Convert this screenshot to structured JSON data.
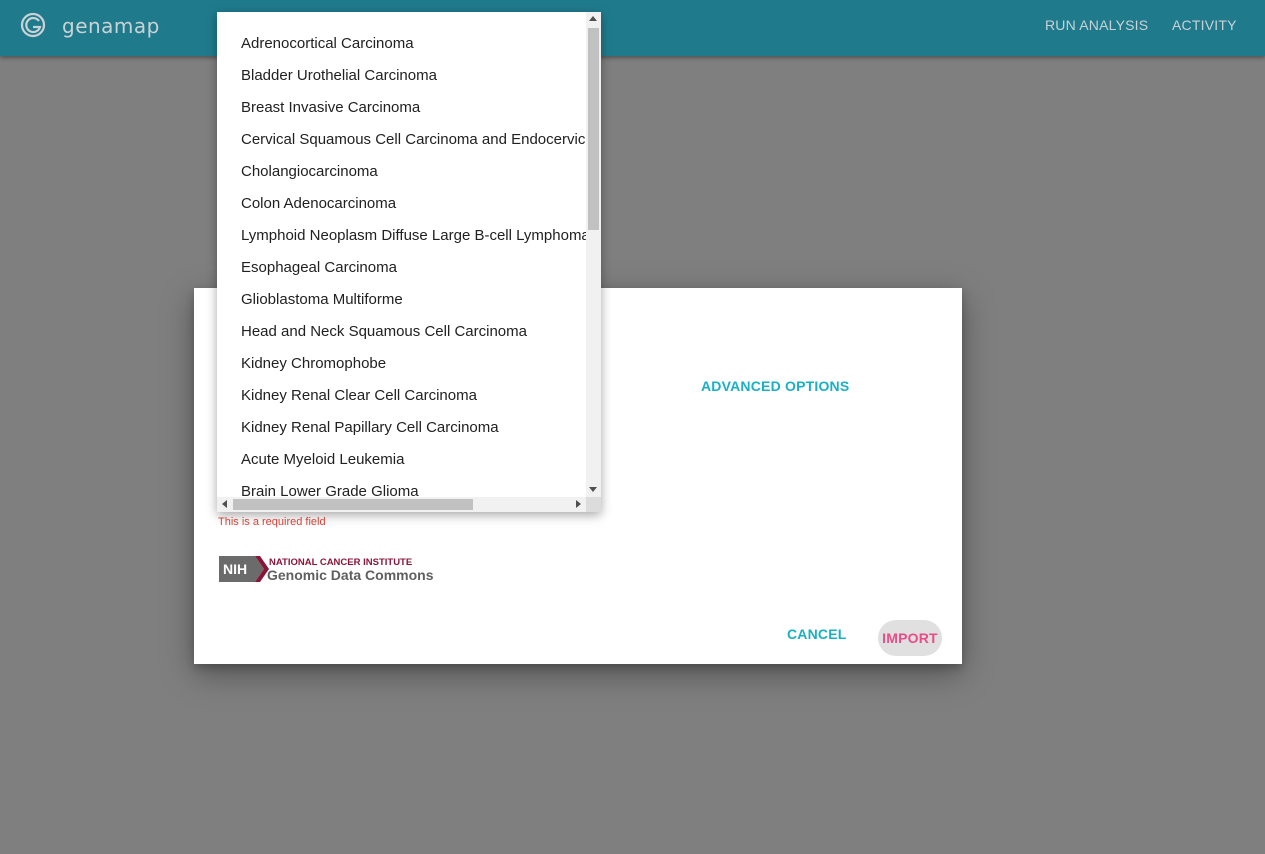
{
  "app": {
    "logo_icon": "genamap-g-logo-icon",
    "name": "genamap",
    "nav": {
      "run_analysis": "RUN ANALYSIS",
      "activity": "ACTIVITY"
    }
  },
  "dialog": {
    "advanced_options": "ADVANCED OPTIONS",
    "error": "This is a required field",
    "nih_logo": {
      "badge": "NIH",
      "line1": "NATIONAL CANCER INSTITUTE",
      "line2": "Genomic Data Commons"
    },
    "cancel_label": "CANCEL",
    "import_label": "IMPORT"
  },
  "dropdown": {
    "items": [
      "Adrenocortical Carcinoma",
      "Bladder Urothelial Carcinoma",
      "Breast Invasive Carcinoma",
      "Cervical Squamous Cell Carcinoma and Endocervical Adenocarcinoma",
      "Cholangiocarcinoma",
      "Colon Adenocarcinoma",
      "Lymphoid Neoplasm Diffuse Large B-cell Lymphoma",
      "Esophageal Carcinoma",
      "Glioblastoma Multiforme",
      "Head and Neck Squamous Cell Carcinoma",
      "Kidney Chromophobe",
      "Kidney Renal Clear Cell Carcinoma",
      "Kidney Renal Papillary Cell Carcinoma",
      "Acute Myeloid Leukemia",
      "Brain Lower Grade Glioma"
    ]
  },
  "colors": {
    "appbar": "#1f7b8c",
    "accent": "#19b0c4",
    "import": "#e84d88",
    "error": "#e0453a"
  }
}
